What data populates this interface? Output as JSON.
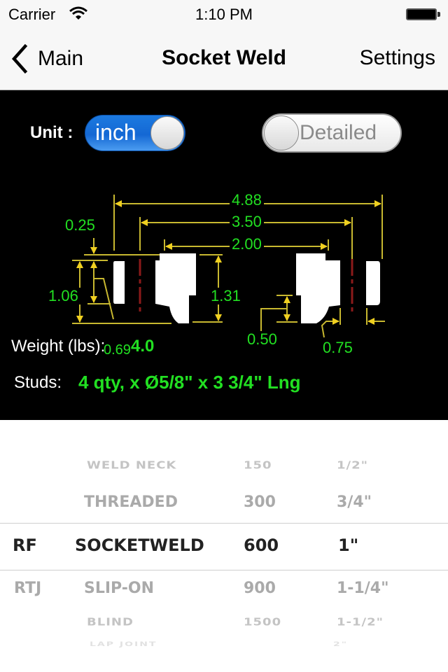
{
  "status_bar": {
    "carrier": "Carrier",
    "time": "1:10 PM"
  },
  "nav": {
    "back_label": "Main",
    "title": "Socket Weld",
    "settings_label": "Settings"
  },
  "controls": {
    "unit_label": "Unit :",
    "unit_toggle": {
      "label": "inch",
      "on": true
    },
    "detail_toggle": {
      "label": "Detailed",
      "on": false
    }
  },
  "diagram": {
    "dimensions": {
      "overall": "4.88",
      "bolt_circle": "3.50",
      "raised_face": "2.00",
      "raised_face_height": "0.25",
      "flange_thickness": "1.06",
      "hub_length": "1.31",
      "socket_depth": "0.50",
      "bolt_hole": "0.75"
    },
    "colors": {
      "dimension_text": "#22e022",
      "dimension_line": "#c8b830",
      "centerline": "#8b1a1a",
      "part": "#ffffff"
    }
  },
  "info": {
    "weight_label": "Weight (lbs):",
    "weight_overlap_text": "0.69",
    "weight_value": "4.0",
    "studs_label": "Studs:",
    "studs_value": "4 qty, x Ø5/8\" x 3 3/4\" Lng"
  },
  "picker": {
    "columns": [
      {
        "name": "facing",
        "items": [
          "RF",
          "RTJ"
        ],
        "selected": "RF"
      },
      {
        "name": "type",
        "items": [
          "WELD NECK",
          "THREADED",
          "SOCKETWELD",
          "SLIP-ON",
          "BLIND",
          "LAP JOINT"
        ],
        "selected": "SOCKETWELD"
      },
      {
        "name": "class",
        "items": [
          "150",
          "300",
          "600",
          "900",
          "1500"
        ],
        "selected": "600"
      },
      {
        "name": "size",
        "items": [
          "1/2\"",
          "3/4\"",
          "1\"",
          "1-1/4\"",
          "1-1/2\"",
          "2\""
        ],
        "selected": "1\""
      }
    ],
    "rows": [
      {
        "facing": "",
        "type": "WELD NECK",
        "class": "150",
        "size": "1/2\""
      },
      {
        "facing": "",
        "type": "THREADED",
        "class": "300",
        "size": "3/4\""
      },
      {
        "facing": "RF",
        "type": "SOCKETWELD",
        "class": "600",
        "size": "1\""
      },
      {
        "facing": "RTJ",
        "type": "SLIP-ON",
        "class": "900",
        "size": "1-1/4\""
      },
      {
        "facing": "",
        "type": "BLIND",
        "class": "1500",
        "size": "1-1/2\""
      },
      {
        "facing": "",
        "type": "LAP JOINT",
        "class": "",
        "size": "2\""
      }
    ]
  }
}
